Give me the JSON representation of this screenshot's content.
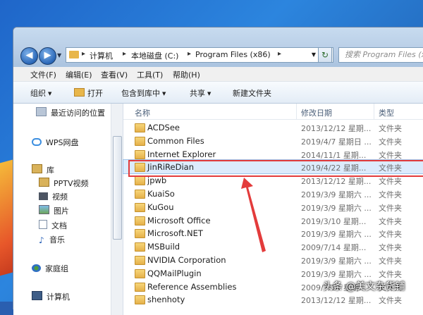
{
  "address": {
    "crumbs": [
      "计算机",
      "本地磁盘 (C:)",
      "Program Files (x86)"
    ]
  },
  "search": {
    "placeholder": "搜索 Program Files (x86)"
  },
  "menu": [
    "文件(F)",
    "编辑(E)",
    "查看(V)",
    "工具(T)",
    "帮助(H)"
  ],
  "toolbar": {
    "organize": "组织",
    "open": "打开",
    "include": "包含到库中",
    "share": "共享",
    "new_folder": "新建文件夹"
  },
  "nav": {
    "recent": "最近访问的位置",
    "wps": "WPS网盘",
    "library": "库",
    "pptv": "PPTV视频",
    "video": "视频",
    "pictures": "图片",
    "docs": "文档",
    "music": "音乐",
    "homegroup": "家庭组",
    "computer": "计算机"
  },
  "columns": {
    "name": "名称",
    "date": "修改日期",
    "type": "类型"
  },
  "files": [
    {
      "name": "ACDSee",
      "date": "2013/12/12 星期...",
      "type": "文件夹"
    },
    {
      "name": "Common Files",
      "date": "2019/4/7 星期日 ...",
      "type": "文件夹"
    },
    {
      "name": "Internet Explorer",
      "date": "2014/11/1 星期...",
      "type": "文件夹"
    },
    {
      "name": "JinRiReDian",
      "date": "2019/4/22 星期...",
      "type": "文件夹"
    },
    {
      "name": "jpwb",
      "date": "2013/12/12 星期...",
      "type": "文件夹"
    },
    {
      "name": "KuaiSo",
      "date": "2019/3/9 星期六 ...",
      "type": "文件夹"
    },
    {
      "name": "KuGou",
      "date": "2019/3/9 星期六 ...",
      "type": "文件夹"
    },
    {
      "name": "Microsoft Office",
      "date": "2019/3/10 星期...",
      "type": "文件夹"
    },
    {
      "name": "Microsoft.NET",
      "date": "2019/3/9 星期六 ...",
      "type": "文件夹"
    },
    {
      "name": "MSBuild",
      "date": "2009/7/14 星期...",
      "type": "文件夹"
    },
    {
      "name": "NVIDIA Corporation",
      "date": "2019/3/9 星期六 ...",
      "type": "文件夹"
    },
    {
      "name": "QQMailPlugin",
      "date": "2019/3/9 星期六 ...",
      "type": "文件夹"
    },
    {
      "name": "Reference Assemblies",
      "date": "2009/7/14 星期...",
      "type": "文件夹"
    },
    {
      "name": "shenhoty",
      "date": "2013/12/12 星期...",
      "type": "文件夹"
    }
  ],
  "watermark": "头条 @美文杂货铺",
  "colors": {
    "highlight": "#e33b3b",
    "selection": "#dcebfc",
    "folder": "#e8b64a"
  }
}
